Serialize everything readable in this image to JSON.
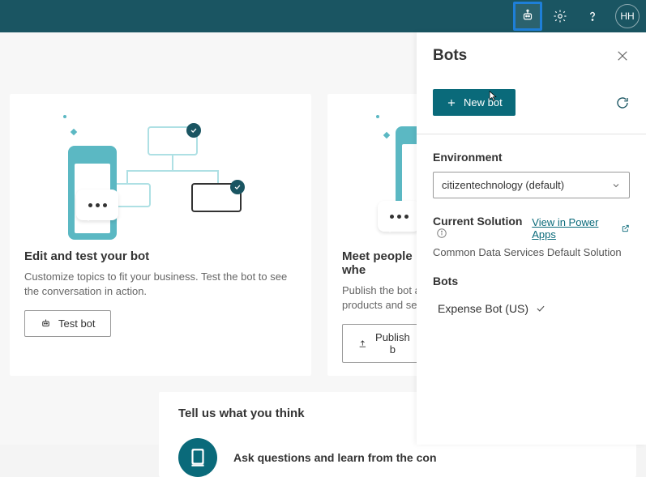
{
  "header": {
    "avatar_initials": "HH"
  },
  "cards": [
    {
      "title": "Edit and test your bot",
      "desc": "Customize topics to fit your business. Test the bot to see the conversation in action.",
      "button": "Test bot"
    },
    {
      "title": "Meet people whe",
      "desc": "Publish the bot a products and ser",
      "button": "Publish b"
    }
  ],
  "feedback": {
    "heading": "Tell us what you think",
    "line1": "Ask questions and learn from the con"
  },
  "panel": {
    "title": "Bots",
    "new_bot": "New bot",
    "env_label": "Environment",
    "env_value": "citizentechnology (default)",
    "current_solution_label": "Current Solution",
    "view_link": "View in Power Apps",
    "solution_name": "Common Data Services Default Solution",
    "bots_label": "Bots",
    "bots": [
      {
        "name": "Expense Bot (US)"
      }
    ]
  }
}
